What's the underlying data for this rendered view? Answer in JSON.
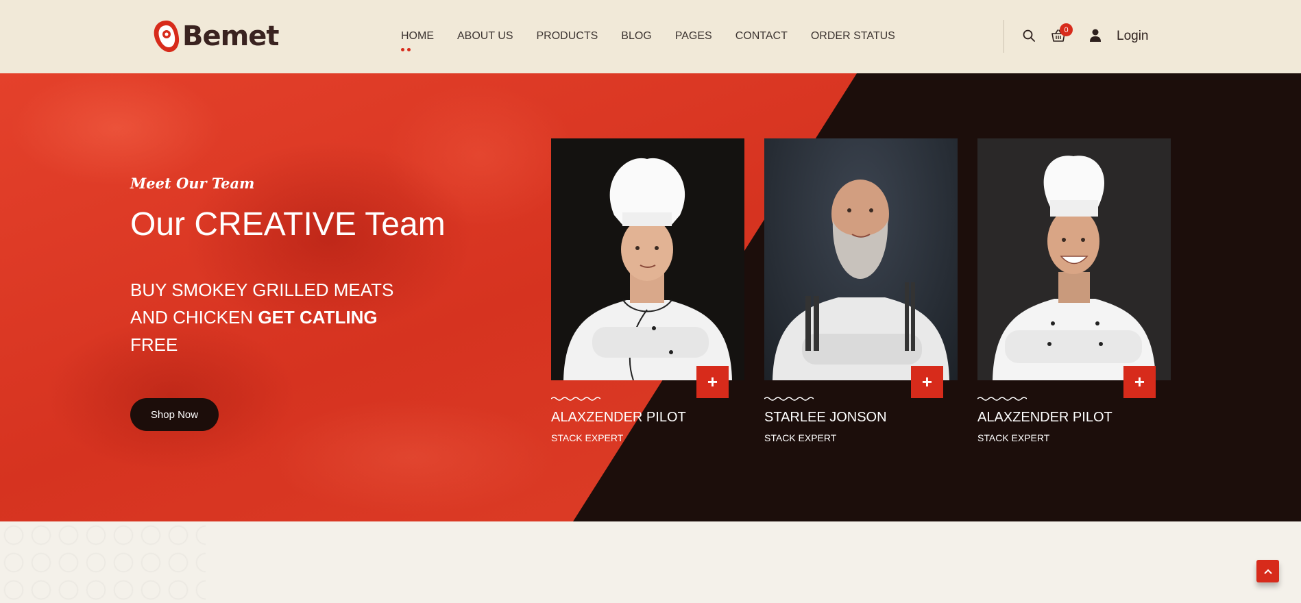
{
  "brand": {
    "name": "Bemet",
    "accent": "#d72b1b",
    "dark": "#1c0e0b",
    "header_bg": "#f1e9d8"
  },
  "nav": {
    "items": [
      {
        "label": "HOME",
        "active": true
      },
      {
        "label": "ABOUT US"
      },
      {
        "label": "PRODUCTS"
      },
      {
        "label": "BLOG"
      },
      {
        "label": "PAGES"
      },
      {
        "label": "CONTACT"
      },
      {
        "label": "ORDER STATUS"
      }
    ]
  },
  "header": {
    "cart_count": "0",
    "login_label": "Login",
    "icons": [
      "search-icon",
      "basket-icon",
      "user-icon"
    ]
  },
  "hero": {
    "subtitle": "Meet Our Team",
    "title": "Our CREATIVE Team",
    "tagline_part1": "BUY SMOKEY GRILLED MEATS AND CHICKEN ",
    "tagline_bold": "GET CATLING",
    "tagline_part2": " FREE",
    "button_label": "Shop Now"
  },
  "team": [
    {
      "name": "ALAXZENDER PILOT",
      "role": "STACK EXPERT",
      "plus": "+"
    },
    {
      "name": "STARLEE JONSON",
      "role": "STACK EXPERT",
      "plus": "+"
    },
    {
      "name": "ALAXZENDER PILOT",
      "role": "STACK EXPERT",
      "plus": "+"
    }
  ]
}
